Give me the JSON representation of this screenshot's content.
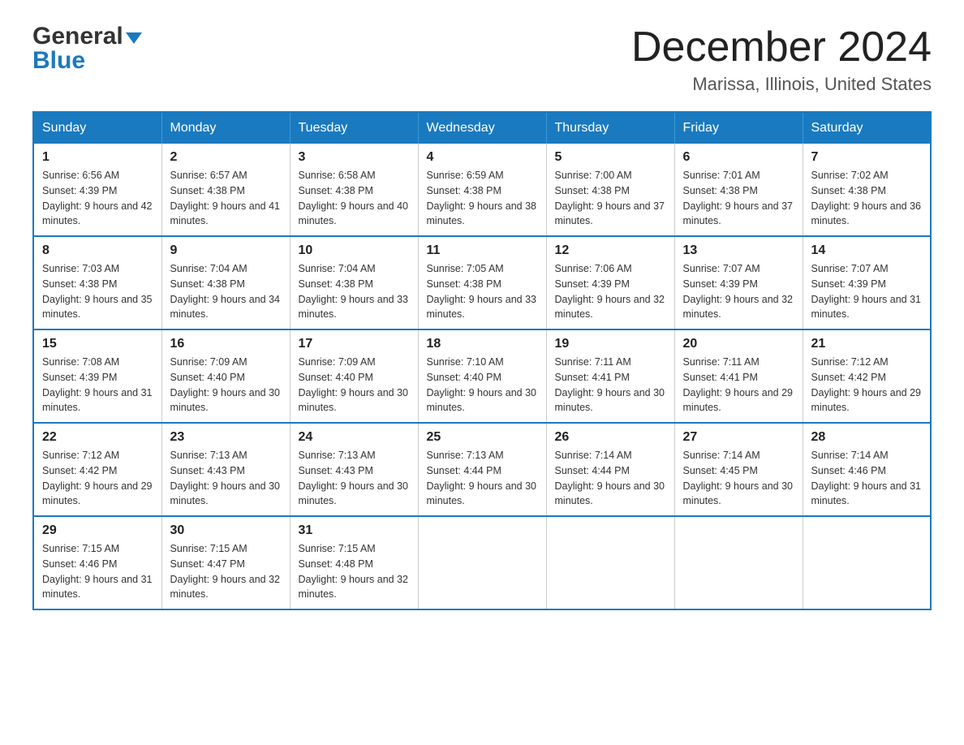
{
  "header": {
    "logo_general": "General",
    "logo_blue": "Blue",
    "month_title": "December 2024",
    "subtitle": "Marissa, Illinois, United States"
  },
  "days_header": [
    "Sunday",
    "Monday",
    "Tuesday",
    "Wednesday",
    "Thursday",
    "Friday",
    "Saturday"
  ],
  "weeks": [
    [
      {
        "day": "1",
        "sunrise": "6:56 AM",
        "sunset": "4:39 PM",
        "daylight": "9 hours and 42 minutes."
      },
      {
        "day": "2",
        "sunrise": "6:57 AM",
        "sunset": "4:38 PM",
        "daylight": "9 hours and 41 minutes."
      },
      {
        "day": "3",
        "sunrise": "6:58 AM",
        "sunset": "4:38 PM",
        "daylight": "9 hours and 40 minutes."
      },
      {
        "day": "4",
        "sunrise": "6:59 AM",
        "sunset": "4:38 PM",
        "daylight": "9 hours and 38 minutes."
      },
      {
        "day": "5",
        "sunrise": "7:00 AM",
        "sunset": "4:38 PM",
        "daylight": "9 hours and 37 minutes."
      },
      {
        "day": "6",
        "sunrise": "7:01 AM",
        "sunset": "4:38 PM",
        "daylight": "9 hours and 37 minutes."
      },
      {
        "day": "7",
        "sunrise": "7:02 AM",
        "sunset": "4:38 PM",
        "daylight": "9 hours and 36 minutes."
      }
    ],
    [
      {
        "day": "8",
        "sunrise": "7:03 AM",
        "sunset": "4:38 PM",
        "daylight": "9 hours and 35 minutes."
      },
      {
        "day": "9",
        "sunrise": "7:04 AM",
        "sunset": "4:38 PM",
        "daylight": "9 hours and 34 minutes."
      },
      {
        "day": "10",
        "sunrise": "7:04 AM",
        "sunset": "4:38 PM",
        "daylight": "9 hours and 33 minutes."
      },
      {
        "day": "11",
        "sunrise": "7:05 AM",
        "sunset": "4:38 PM",
        "daylight": "9 hours and 33 minutes."
      },
      {
        "day": "12",
        "sunrise": "7:06 AM",
        "sunset": "4:39 PM",
        "daylight": "9 hours and 32 minutes."
      },
      {
        "day": "13",
        "sunrise": "7:07 AM",
        "sunset": "4:39 PM",
        "daylight": "9 hours and 32 minutes."
      },
      {
        "day": "14",
        "sunrise": "7:07 AM",
        "sunset": "4:39 PM",
        "daylight": "9 hours and 31 minutes."
      }
    ],
    [
      {
        "day": "15",
        "sunrise": "7:08 AM",
        "sunset": "4:39 PM",
        "daylight": "9 hours and 31 minutes."
      },
      {
        "day": "16",
        "sunrise": "7:09 AM",
        "sunset": "4:40 PM",
        "daylight": "9 hours and 30 minutes."
      },
      {
        "day": "17",
        "sunrise": "7:09 AM",
        "sunset": "4:40 PM",
        "daylight": "9 hours and 30 minutes."
      },
      {
        "day": "18",
        "sunrise": "7:10 AM",
        "sunset": "4:40 PM",
        "daylight": "9 hours and 30 minutes."
      },
      {
        "day": "19",
        "sunrise": "7:11 AM",
        "sunset": "4:41 PM",
        "daylight": "9 hours and 30 minutes."
      },
      {
        "day": "20",
        "sunrise": "7:11 AM",
        "sunset": "4:41 PM",
        "daylight": "9 hours and 29 minutes."
      },
      {
        "day": "21",
        "sunrise": "7:12 AM",
        "sunset": "4:42 PM",
        "daylight": "9 hours and 29 minutes."
      }
    ],
    [
      {
        "day": "22",
        "sunrise": "7:12 AM",
        "sunset": "4:42 PM",
        "daylight": "9 hours and 29 minutes."
      },
      {
        "day": "23",
        "sunrise": "7:13 AM",
        "sunset": "4:43 PM",
        "daylight": "9 hours and 30 minutes."
      },
      {
        "day": "24",
        "sunrise": "7:13 AM",
        "sunset": "4:43 PM",
        "daylight": "9 hours and 30 minutes."
      },
      {
        "day": "25",
        "sunrise": "7:13 AM",
        "sunset": "4:44 PM",
        "daylight": "9 hours and 30 minutes."
      },
      {
        "day": "26",
        "sunrise": "7:14 AM",
        "sunset": "4:44 PM",
        "daylight": "9 hours and 30 minutes."
      },
      {
        "day": "27",
        "sunrise": "7:14 AM",
        "sunset": "4:45 PM",
        "daylight": "9 hours and 30 minutes."
      },
      {
        "day": "28",
        "sunrise": "7:14 AM",
        "sunset": "4:46 PM",
        "daylight": "9 hours and 31 minutes."
      }
    ],
    [
      {
        "day": "29",
        "sunrise": "7:15 AM",
        "sunset": "4:46 PM",
        "daylight": "9 hours and 31 minutes."
      },
      {
        "day": "30",
        "sunrise": "7:15 AM",
        "sunset": "4:47 PM",
        "daylight": "9 hours and 32 minutes."
      },
      {
        "day": "31",
        "sunrise": "7:15 AM",
        "sunset": "4:48 PM",
        "daylight": "9 hours and 32 minutes."
      },
      null,
      null,
      null,
      null
    ]
  ],
  "labels": {
    "sunrise": "Sunrise:",
    "sunset": "Sunset:",
    "daylight": "Daylight:"
  }
}
